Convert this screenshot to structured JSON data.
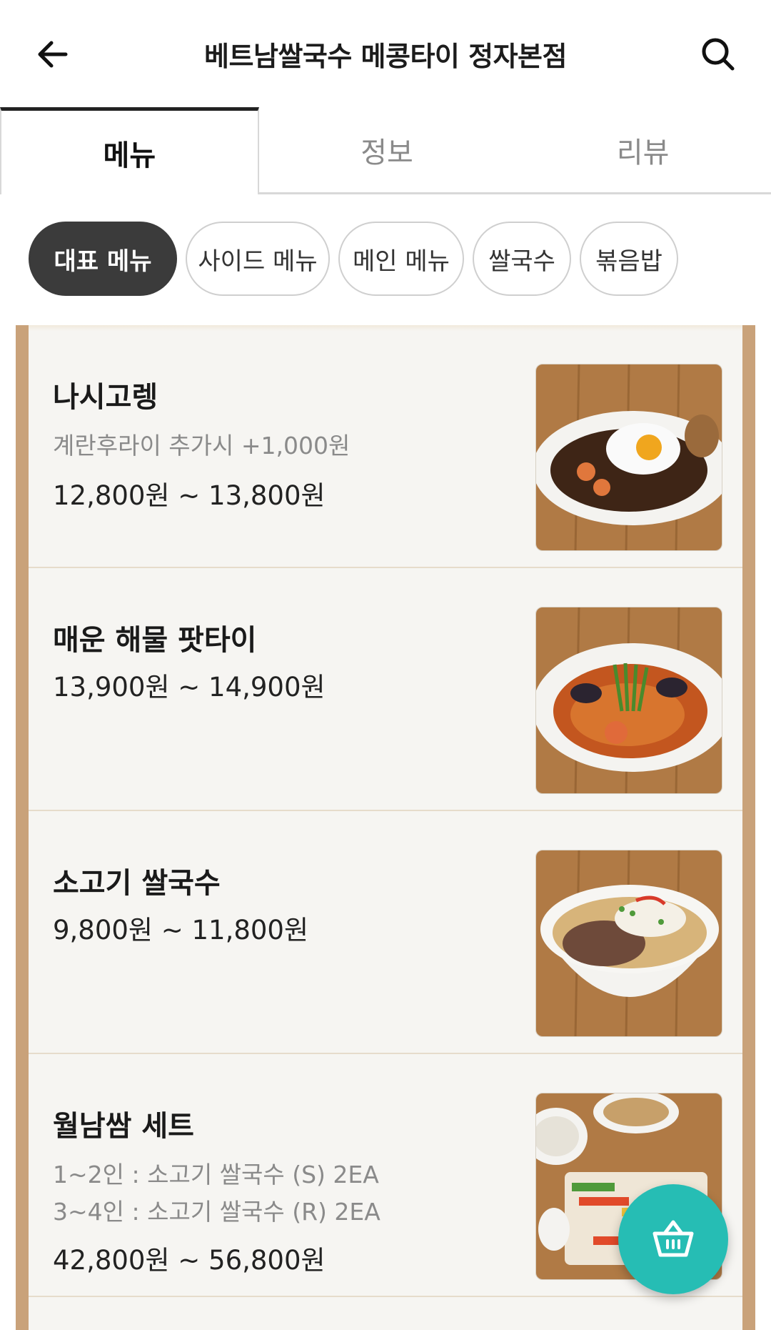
{
  "header": {
    "title": "베트남쌀국수 메콩타이 정자본점",
    "back_icon": "arrow-left-icon",
    "search_icon": "search-icon"
  },
  "tabs": [
    {
      "label": "메뉴",
      "active": true
    },
    {
      "label": "정보",
      "active": false
    },
    {
      "label": "리뷰",
      "active": false
    }
  ],
  "chips": [
    {
      "label": "대표 메뉴",
      "active": true
    },
    {
      "label": "사이드 메뉴",
      "active": false
    },
    {
      "label": "메인 메뉴",
      "active": false
    },
    {
      "label": "쌀국수",
      "active": false
    },
    {
      "label": "볶음밥",
      "active": false
    }
  ],
  "menu_items": [
    {
      "name": "나시고렝",
      "desc": [
        "계란후라이 추가시 +1,000원"
      ],
      "price": "12,800원 ~ 13,800원",
      "image_icon": "nasi-goreng-photo"
    },
    {
      "name": "매운 해물 팟타이",
      "desc": [],
      "price": "13,900원 ~ 14,900원",
      "image_icon": "pad-thai-photo"
    },
    {
      "name": "소고기 쌀국수",
      "desc": [],
      "price": "9,800원 ~ 11,800원",
      "image_icon": "beef-pho-photo"
    },
    {
      "name": "월남쌈 세트",
      "desc": [
        "1~2인 : 소고기 쌀국수 (S) 2EA",
        "3~4인 : 소고기 쌀국수 (R) 2EA"
      ],
      "price": "42,800원 ~ 56,800원",
      "image_icon": "spring-roll-set-photo"
    }
  ],
  "fab": {
    "icon": "basket-icon"
  },
  "colors": {
    "accent_teal": "#26bdb4",
    "chip_active": "#3b3b3b",
    "board_frame": "#c9a27a",
    "board_bg": "#f6f5f2"
  }
}
